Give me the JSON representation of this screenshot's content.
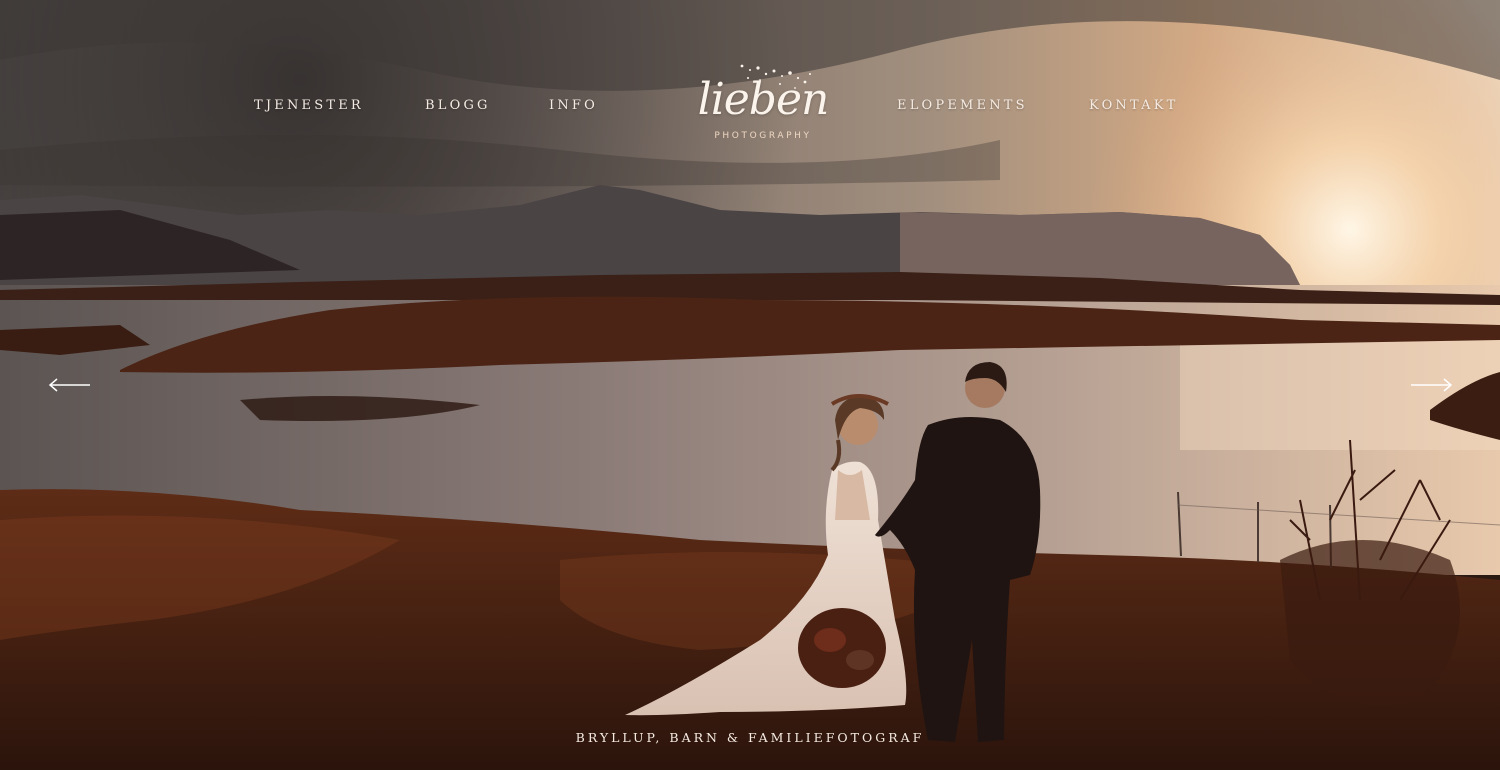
{
  "nav": {
    "items": [
      {
        "label": "TJENESTER"
      },
      {
        "label": "BLOGG"
      },
      {
        "label": "INFO"
      },
      {
        "label": "ELOPEMENTS"
      },
      {
        "label": "KONTAKT"
      }
    ]
  },
  "logo": {
    "script": "lieben",
    "subtitle": "PHOTOGRAPHY"
  },
  "slider": {
    "prev_icon": "arrow-left-icon",
    "next_icon": "arrow-right-icon"
  },
  "tagline": "BRYLLUP, BARN & FAMILIEFOTOGRAF",
  "colors": {
    "nav_text": "#f4ebe3",
    "sky_warm": "#e9b98c",
    "ground": "#5a2a14",
    "water": "#9d8a86"
  }
}
